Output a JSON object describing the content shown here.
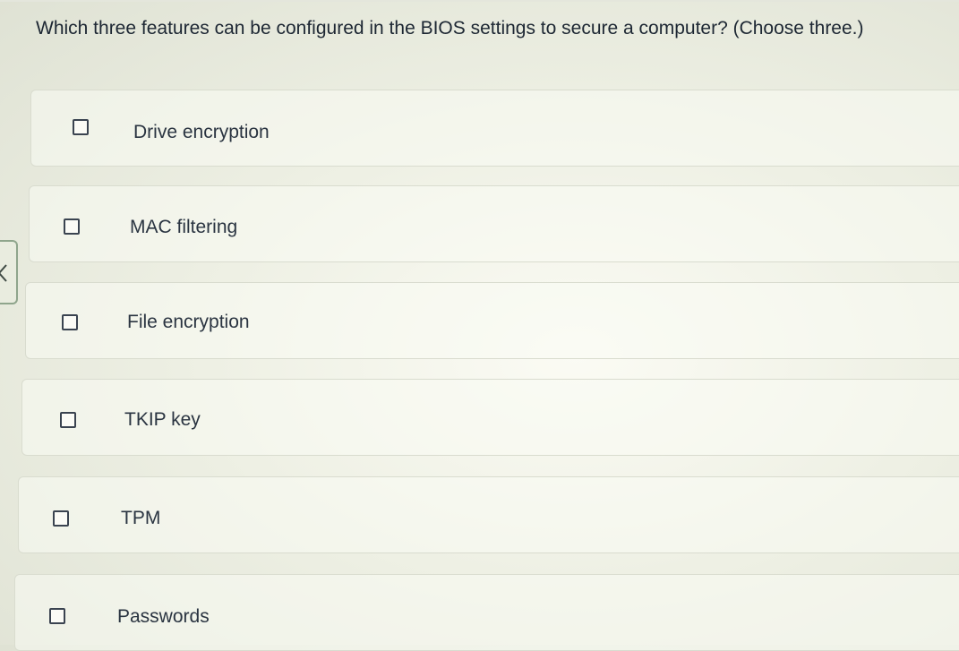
{
  "question": {
    "text": "Which three features can be configured in the BIOS settings to secure a computer? (Choose three.)"
  },
  "options": [
    {
      "label": "Drive encryption",
      "checked": false
    },
    {
      "label": "MAC filtering",
      "checked": false
    },
    {
      "label": "File encryption",
      "checked": false
    },
    {
      "label": "TKIP key",
      "checked": false
    },
    {
      "label": "TPM",
      "checked": false
    },
    {
      "label": "Passwords",
      "checked": false
    }
  ],
  "nav": {
    "previous_icon": "chevron-left-icon"
  }
}
